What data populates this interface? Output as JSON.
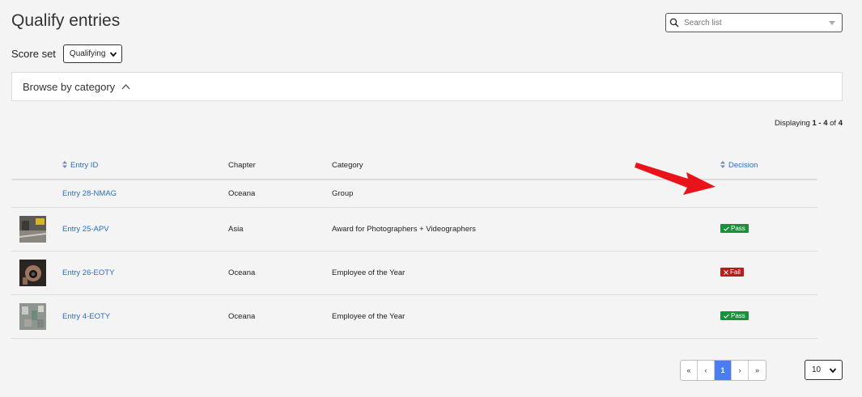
{
  "page": {
    "title": "Qualify entries"
  },
  "search": {
    "placeholder": "Search list"
  },
  "score_set": {
    "label": "Score set",
    "selected": "Qualifying"
  },
  "browse": {
    "label": "Browse by category"
  },
  "displaying": {
    "prefix": "Displaying ",
    "range": "1 - 4",
    "of_text": " of ",
    "total": "4"
  },
  "table": {
    "headers": {
      "entry_id": "Entry ID",
      "chapter": "Chapter",
      "category": "Category",
      "decision": "Decision"
    },
    "rows": [
      {
        "entry": "Entry 28-NMAG",
        "chapter": "Oceana",
        "category": "Group",
        "decision": ""
      },
      {
        "entry": "Entry 25-APV",
        "chapter": "Asia",
        "category": "Award for Photographers + Videographers",
        "decision": "Pass"
      },
      {
        "entry": "Entry 26-EOTY",
        "chapter": "Oceana",
        "category": "Employee of the Year",
        "decision": "Fail"
      },
      {
        "entry": "Entry 4-EOTY",
        "chapter": "Oceana",
        "category": "Employee of the Year",
        "decision": "Pass"
      }
    ]
  },
  "pagination": {
    "first": "«",
    "prev": "‹",
    "current": "1",
    "next": "›",
    "last": "»"
  },
  "per_page": {
    "selected": "10"
  },
  "colors": {
    "link": "#2b6cc4",
    "pass": "#1a8f3c",
    "fail": "#b61d1d",
    "active_page": "#4a7cf2",
    "annotation_arrow": "#e8141a"
  }
}
